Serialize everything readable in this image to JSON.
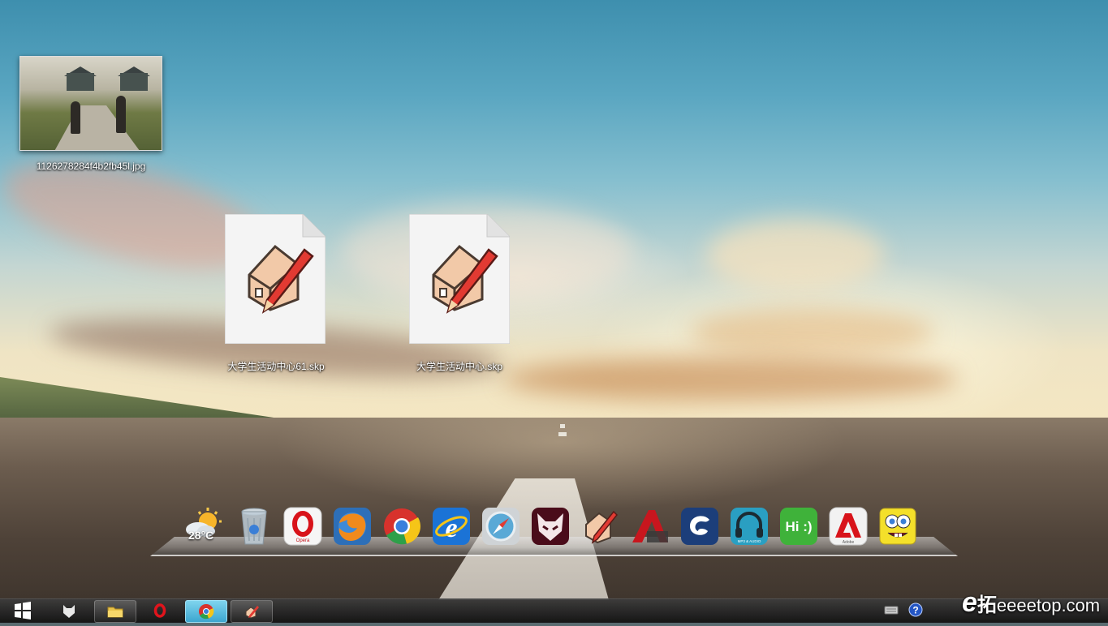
{
  "desktop": {
    "icons": [
      {
        "label": "1126278284f4b2fb45l.jpg",
        "type": "image"
      },
      {
        "label": "大学生活动中心61.skp",
        "type": "sketchup-file"
      },
      {
        "label": "大学生活动中心.skp",
        "type": "sketchup-file"
      }
    ]
  },
  "dock": {
    "weather": {
      "temperature": "28°C",
      "icon": "partly-sunny-icon"
    },
    "items": [
      {
        "name": "recycle-bin",
        "icon": "recycle-bin-icon"
      },
      {
        "name": "opera",
        "icon": "opera-icon",
        "caption": "Opera"
      },
      {
        "name": "firefox",
        "icon": "firefox-icon"
      },
      {
        "name": "chrome",
        "icon": "chrome-icon"
      },
      {
        "name": "internet-explorer",
        "icon": "ie-icon"
      },
      {
        "name": "safari",
        "icon": "safari-icon"
      },
      {
        "name": "fox-app",
        "icon": "fox-mask-icon"
      },
      {
        "name": "sketchup",
        "icon": "sketchup-icon"
      },
      {
        "name": "autocad",
        "icon": "autocad-icon"
      },
      {
        "name": "3ds-max",
        "icon": "3dsmax-icon"
      },
      {
        "name": "mp3-audio",
        "icon": "headphones-icon",
        "caption": "MP3 & AUDIO"
      },
      {
        "name": "messenger",
        "icon": "chat-bubble-icon",
        "caption": "Hi :)"
      },
      {
        "name": "adobe",
        "icon": "adobe-icon",
        "caption": "Adobe"
      },
      {
        "name": "spongebob",
        "icon": "spongebob-icon"
      }
    ]
  },
  "taskbar": {
    "start_icon": "windows-logo-icon",
    "pinned": [
      {
        "name": "fox",
        "icon": "fox-icon"
      },
      {
        "name": "explorer",
        "icon": "folder-icon"
      },
      {
        "name": "opera",
        "icon": "opera-icon"
      },
      {
        "name": "chrome",
        "icon": "chrome-icon",
        "active": true
      },
      {
        "name": "sketchup",
        "icon": "sketchup-icon"
      }
    ],
    "tray": [
      {
        "name": "keyboard",
        "icon": "keyboard-icon"
      },
      {
        "name": "help",
        "icon": "help-icon",
        "text": "?"
      }
    ]
  },
  "watermark": {
    "logo": "e",
    "cn": "拓",
    "site": "eeeetop.com"
  }
}
